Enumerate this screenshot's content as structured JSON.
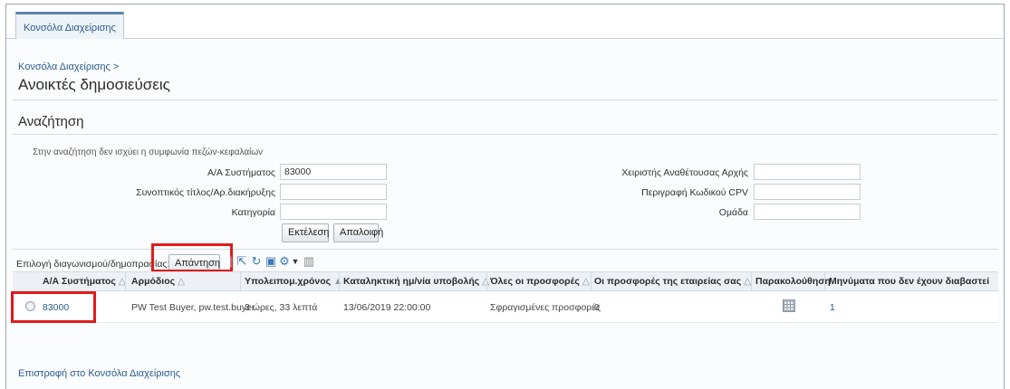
{
  "tab": {
    "label": "Κονσόλα Διαχείρισης"
  },
  "breadcrumb": "Κονσόλα Διαχείρισης >",
  "page_title": "Ανοικτές δημοσιεύσεις",
  "search": {
    "title": "Αναζήτηση",
    "hint": "Στην αναζήτηση δεν ισχύει η συμφωνία πεζών-κεφαλαίων",
    "fields": {
      "system_no": {
        "label": "Α/Α Συστήματος",
        "value": "83000"
      },
      "short_title": {
        "label": "Συνοπτικός τίτλος/Αρ.διακήρυξης",
        "value": ""
      },
      "category": {
        "label": "Κατηγορία",
        "value": ""
      },
      "handler": {
        "label": "Χειριστής Αναθέτουσας Αρχής",
        "value": ""
      },
      "cpv": {
        "label": "Περιγραφή Κωδικού CPV",
        "value": ""
      },
      "group": {
        "label": "Ομάδα",
        "value": ""
      }
    },
    "execute_label": "Εκτέλεση",
    "clear_label": "Απαλοιφή"
  },
  "toolbar": {
    "select_label": "Επιλογή διαγωνισμού/δημοπρασίας:",
    "reply_label": "Απάντηση"
  },
  "table": {
    "columns": [
      {
        "label": "Α/Α Συστήματος",
        "sort": "△"
      },
      {
        "label": "Αρμόδιος",
        "sort": "△"
      },
      {
        "label": "Υπολειπομ.χρόνος",
        "sort": "▲"
      },
      {
        "label": "Καταληκτική ημ/νία υποβολής",
        "sort": "△"
      },
      {
        "label": "Όλες οι προσφορές",
        "sort": "△"
      },
      {
        "label": "Οι προσφορές της εταιρείας σας",
        "sort": "△"
      },
      {
        "label": "Παρακολούθηση",
        "sort": ""
      },
      {
        "label": "Μηνύματα που δεν έχουν διαβαστεί",
        "sort": ""
      }
    ],
    "rows": [
      {
        "system_no": "83000",
        "owner": "PW Test Buyer, pw.test.buyer",
        "remaining": "3 ώρες, 33 λεπτά",
        "deadline": "13/06/2019 22:00:00",
        "all_offers": "Σφραγισμένες προσφορές",
        "your_offers": "0",
        "unread": "1"
      }
    ]
  },
  "footer_link": "Επιστροφή στο Κονσόλα Διαχείρισης",
  "colors": {
    "link": "#2a5d8f",
    "highlight": "#e01b1b",
    "header_bg": "#edf1f5"
  }
}
